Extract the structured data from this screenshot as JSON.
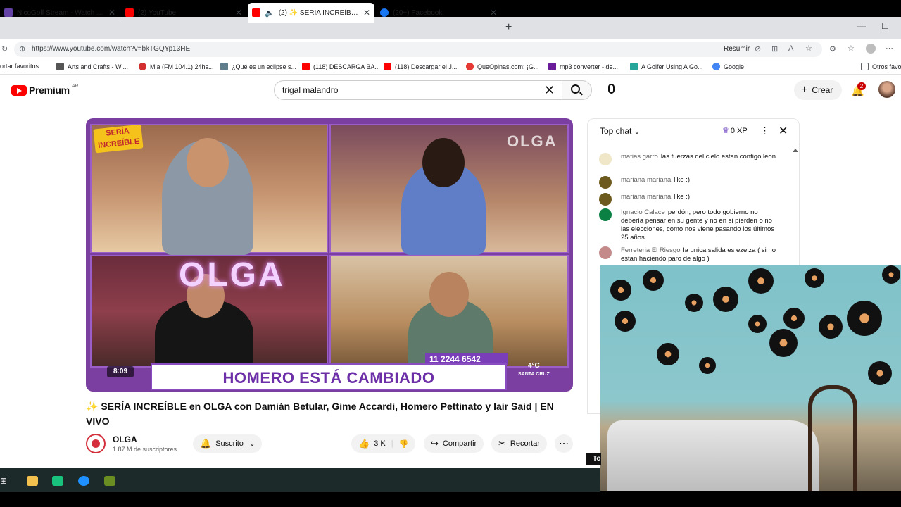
{
  "browser": {
    "tabs": [
      {
        "title": "NicoGolf Stream - Watch Live on",
        "color": "#6441a5"
      },
      {
        "title": "(2) YouTube",
        "color": "#ff0000"
      },
      {
        "title": "(2) ✨ SERÍA INCREÍBLE en C",
        "color": "#ff0000"
      },
      {
        "title": "(20+) Facebook",
        "color": "#1877f2"
      }
    ],
    "url": "https://www.youtube.com/watch?v=bkTGQYp13HE",
    "resumir": "Resumir",
    "bookmarks": [
      {
        "label": "ortar favoritos",
        "color": ""
      },
      {
        "label": "Arts and Crafts - Wi...",
        "color": "#555555"
      },
      {
        "label": "Mia (FM 104.1) 24hs...",
        "color": "#d32f2f"
      },
      {
        "label": "¿Qué es un eclipse s...",
        "color": "#607d8b"
      },
      {
        "label": "(118) DESCARGA BA...",
        "color": "#ff0000"
      },
      {
        "label": "(118) Descargar el J...",
        "color": "#ff0000"
      },
      {
        "label": "QueOpinas.com: ¡G...",
        "color": "#e53935"
      },
      {
        "label": "mp3 converter - de...",
        "color": "#6a1b9a"
      },
      {
        "label": "A Golfer Using A Go...",
        "color": "#26a69a"
      },
      {
        "label": "Google",
        "color": "#4285f4"
      },
      {
        "label": "Otros favo",
        "color": ""
      }
    ]
  },
  "youtube": {
    "logo": "Premium",
    "country": "AR",
    "search_value": "trigal malandro",
    "create_label": "Crear",
    "notifications": "2"
  },
  "video": {
    "overlay_logo": "SERÍA INCREÍBLE",
    "watermark": "OLGA",
    "neon": "OLGA",
    "banner": "HOMERO ESTÁ CAMBIADO",
    "phone": "11 2244 6542",
    "time": "8:09",
    "temp": "4°C",
    "city": "SANTA CRUZ",
    "title": "✨ SERÍA INCREÍBLE en OLGA con Damián Betular, Gime Accardi, Homero Pettinato y Iair Said | EN VIVO",
    "channel": "OLGA",
    "subscribers": "1.87 M de suscriptores",
    "subscribed_label": "Suscrito",
    "likes": "3 K",
    "share_label": "Compartir",
    "clip_label": "Recortar"
  },
  "chat": {
    "header": "Top chat",
    "xp": "0 XP",
    "messages": [
      {
        "author": "matias garro",
        "text": "las fuerzas del cielo estan contigo leon",
        "color": "#f0e6c8"
      },
      {
        "author": "mariana mariana",
        "text": "like :)",
        "color": "#6d5a1e"
      },
      {
        "author": "mariana mariana",
        "text": "like :)",
        "color": "#6d5a1e"
      },
      {
        "author": "Ignacio Calace",
        "text": "perdón, pero todo gobierno no debería pensar en su gente y no en si pierden o no las elecciones, como nos viene pasando los últimos 25 años.",
        "color": "#0b8043"
      },
      {
        "author": "Ferreteria El Riesgo",
        "text": "la unica salida es ezeiza ( si no estan haciendo paro de algo )",
        "color": "#c48a8a"
      }
    ],
    "to_tag": "To"
  }
}
